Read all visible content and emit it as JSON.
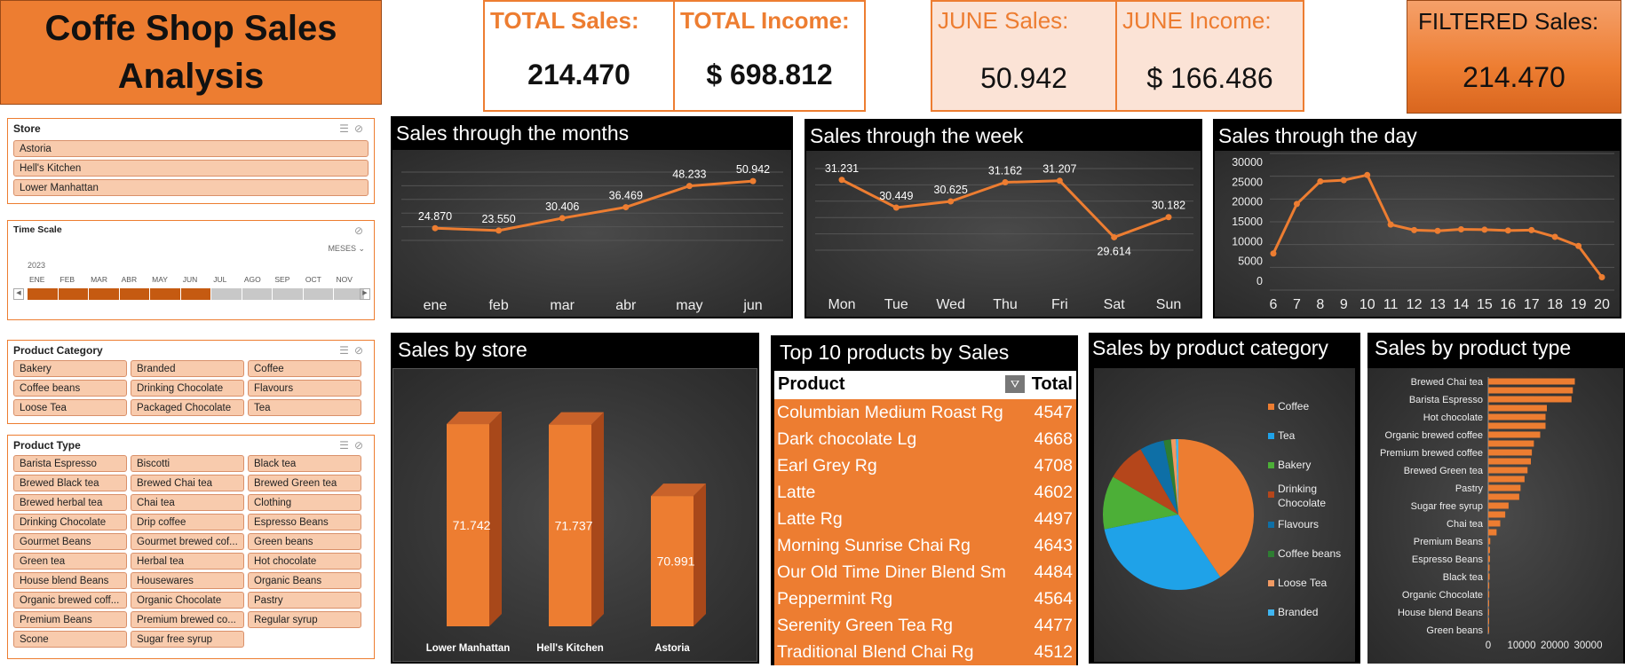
{
  "title": "Coffe Shop Sales Analysis",
  "kpis": {
    "total_sales": {
      "label": "TOTAL Sales:",
      "value": "214.470"
    },
    "total_income": {
      "label": "TOTAL Income:",
      "value": "$ 698.812"
    },
    "june_sales": {
      "label": "JUNE Sales:",
      "value": "50.942"
    },
    "june_income": {
      "label": "JUNE Income:",
      "value": "$ 166.486"
    },
    "filtered_sales": {
      "label": "FILTERED Sales:",
      "value": "214.470"
    }
  },
  "slicers": {
    "store": {
      "title": "Store",
      "items": [
        "Astoria",
        "Hell's Kitchen",
        "Lower Manhattan"
      ]
    },
    "time_scale": {
      "title": "Time Scale",
      "level": "MESES",
      "year": "2023",
      "months": [
        "ENE",
        "FEB",
        "MAR",
        "ABR",
        "MAY",
        "JUN",
        "JUL",
        "AGO",
        "SEP",
        "OCT",
        "NOV"
      ],
      "selected_count": 6
    },
    "product_category": {
      "title": "Product Category",
      "items": [
        "Bakery",
        "Branded",
        "Coffee",
        "Coffee beans",
        "Drinking Chocolate",
        "Flavours",
        "Loose Tea",
        "Packaged Chocolate",
        "Tea"
      ]
    },
    "product_type": {
      "title": "Product Type",
      "items": [
        "Barista Espresso",
        "Biscotti",
        "Black tea",
        "Brewed Black tea",
        "Brewed Chai tea",
        "Brewed Green tea",
        "Brewed herbal tea",
        "Chai tea",
        "Clothing",
        "Drinking Chocolate",
        "Drip coffee",
        "Espresso Beans",
        "Gourmet Beans",
        "Gourmet brewed cof...",
        "Green beans",
        "Green tea",
        "Herbal tea",
        "Hot chocolate",
        "House blend Beans",
        "Housewares",
        "Organic Beans",
        "Organic brewed coff...",
        "Organic Chocolate",
        "Pastry",
        "Premium Beans",
        "Premium brewed co...",
        "Regular syrup",
        "Scone",
        "Sugar free syrup"
      ]
    }
  },
  "chart_data": [
    {
      "id": "months",
      "type": "line",
      "title": "Sales through the months",
      "categories": [
        "ene",
        "feb",
        "mar",
        "abr",
        "may",
        "jun"
      ],
      "values": [
        24870,
        23550,
        30406,
        36469,
        48233,
        50942
      ],
      "labels": [
        "24.870",
        "23.550",
        "30.406",
        "36.469",
        "48.233",
        "50.942"
      ],
      "color": "#ED7D31"
    },
    {
      "id": "week",
      "type": "line",
      "title": "Sales through the week",
      "categories": [
        "Mon",
        "Tue",
        "Wed",
        "Thu",
        "Fri",
        "Sat",
        "Sun"
      ],
      "values": [
        31231,
        30449,
        30625,
        31162,
        31207,
        29614,
        30182
      ],
      "labels": [
        "31.231",
        "30.449",
        "30.625",
        "31.162",
        "31.207",
        "29.614",
        "30.182"
      ],
      "color": "#ED7D31"
    },
    {
      "id": "day",
      "type": "line",
      "title": "Sales through the day",
      "categories": [
        "6",
        "7",
        "8",
        "9",
        "10",
        "11",
        "12",
        "13",
        "14",
        "15",
        "16",
        "17",
        "18",
        "19",
        "20"
      ],
      "values": [
        7000,
        19500,
        25200,
        25500,
        26800,
        14300,
        12900,
        12700,
        13100,
        13000,
        12800,
        12900,
        11200,
        8900,
        1000
      ],
      "ylim": [
        0,
        30000
      ],
      "yticks": [
        "0",
        "5000",
        "10000",
        "15000",
        "20000",
        "25000",
        "30000"
      ],
      "color": "#ED7D31"
    },
    {
      "id": "store",
      "type": "bar",
      "title": "Sales by store",
      "categories": [
        "Lower Manhattan",
        "Hell's Kitchen",
        "Astoria"
      ],
      "values": [
        71742,
        71737,
        70991
      ],
      "labels": [
        "71.742",
        "71.737",
        "70.991"
      ],
      "color": "#ED7D31"
    },
    {
      "id": "top10",
      "type": "table",
      "title": "Top 10 products by Sales",
      "columns": [
        "Product",
        "Total"
      ],
      "rows": [
        [
          "Columbian Medium Roast Rg",
          "4547"
        ],
        [
          "Dark chocolate Lg",
          "4668"
        ],
        [
          "Earl Grey Rg",
          "4708"
        ],
        [
          "Latte",
          "4602"
        ],
        [
          "Latte Rg",
          "4497"
        ],
        [
          "Morning Sunrise Chai Rg",
          "4643"
        ],
        [
          "Our Old Time Diner Blend Sm",
          "4484"
        ],
        [
          "Peppermint Rg",
          "4564"
        ],
        [
          "Serenity Green Tea Rg",
          "4477"
        ],
        [
          "Traditional Blend Chai Rg",
          "4512"
        ]
      ]
    },
    {
      "id": "category",
      "type": "pie",
      "title": "Sales by product category",
      "legend": [
        "Coffee",
        "Tea",
        "Bakery",
        "Drinking Chocolate",
        "Flavours",
        "Coffee beans",
        "Loose Tea",
        "Branded"
      ],
      "values": [
        39,
        30,
        11,
        8,
        5,
        1.5,
        1,
        0.5
      ],
      "colors": [
        "#ED7D31",
        "#1FA2E8",
        "#4CAF37",
        "#B5461B",
        "#0E6FA6",
        "#2E7D32",
        "#F19A63",
        "#3FB5F0"
      ]
    },
    {
      "id": "type",
      "type": "bar",
      "orientation": "horizontal",
      "title": "Sales by product type",
      "categories": [
        "Brewed Chai tea",
        "Barista Espresso",
        "Hot chocolate",
        "Organic brewed coffee",
        "Premium brewed coffee",
        "Brewed Green tea",
        "Pastry",
        "Sugar free syrup",
        "Chai tea",
        "Premium Beans",
        "Espresso Beans",
        "Black tea",
        "Organic Chocolate",
        "House blend Beans",
        "Green beans"
      ],
      "values": [
        26000,
        25400,
        25000,
        17600,
        17200,
        17200,
        15600,
        13700,
        13100,
        12800,
        11800,
        10900,
        9700,
        9300,
        6100,
        5100,
        3600,
        2500,
        600,
        500,
        500,
        400,
        400,
        300,
        300,
        200,
        200,
        200,
        100
      ],
      "xticks": [
        "0",
        "10000",
        "20000",
        "30000"
      ],
      "xlim": [
        0,
        32000
      ],
      "color": "#ED7D31"
    }
  ]
}
